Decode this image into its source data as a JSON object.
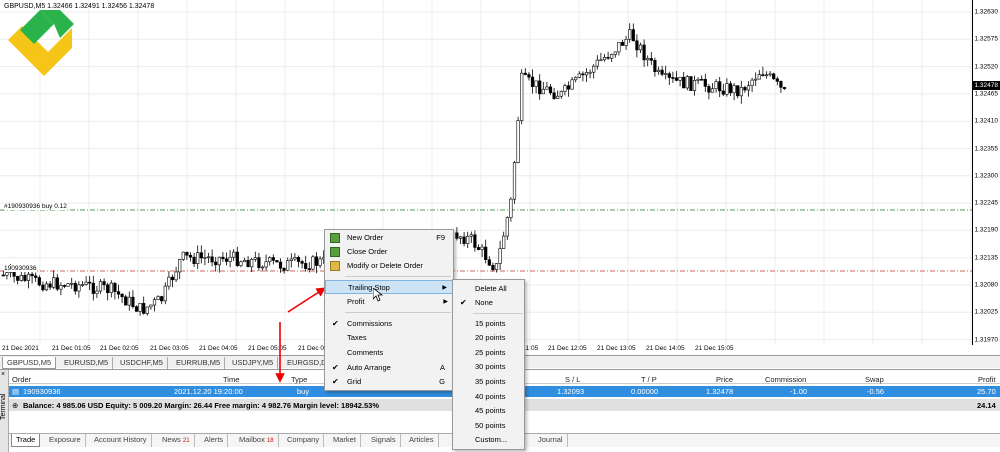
{
  "chart": {
    "title": "GBPUSD,M5   1.32466 1.32491 1.32456 1.32478",
    "price_labels": [
      "1.32630",
      "1.32575",
      "1.32520",
      "1.32465",
      "1.32410",
      "1.32355",
      "1.32300",
      "1.32245",
      "1.32190",
      "1.32135",
      "1.32080",
      "1.32025",
      "1.31970"
    ],
    "current_price": "1.32478",
    "time_labels": [
      "21 Dec 2021",
      "21 Dec 01:05",
      "21 Dec 02:05",
      "21 Dec 03:05",
      "21 Dec 04:05",
      "21 Dec 05:05",
      "21 Dec 06:05",
      "21 Dec 11:05",
      "21 Dec 12:05",
      "21 Dec 13:05",
      "21 Dec 14:05",
      "21 Dec 15:05"
    ],
    "tp_label": "#190930936 buy 0.12",
    "entry_label": "190930936"
  },
  "chart_tabs": [
    "GBPUSD,M5",
    "EURUSD,M5",
    "USDCHF,M5",
    "EURRUB,M5",
    "USDJPY,M5",
    "EURGSD,D"
  ],
  "terminal": {
    "side_title": "Terminal",
    "headers": [
      "Order",
      "Time",
      "Type",
      "S / L",
      "T / P",
      "Price",
      "Commission",
      "Swap",
      "Profit"
    ],
    "row": {
      "order": "190930936",
      "time": "2021.12.20 19:20:00",
      "type": "buy",
      "sl": "1.32093",
      "tp": "0.00000",
      "price": "1.32478",
      "commission": "-1.00",
      "swap": "-0.56",
      "profit": "25.70"
    },
    "balance": "Balance: 4 985.06 USD  Equity: 5 009.20  Margin: 26.44  Free margin: 4 982.76  Margin level: 18942.53%",
    "balance_profit": "24.14",
    "tabs": [
      {
        "label": "Trade",
        "badge": ""
      },
      {
        "label": "Exposure",
        "badge": ""
      },
      {
        "label": "Account History",
        "badge": ""
      },
      {
        "label": "News",
        "badge": "21"
      },
      {
        "label": "Alerts",
        "badge": ""
      },
      {
        "label": "Mailbox",
        "badge": "18"
      },
      {
        "label": "Company",
        "badge": ""
      },
      {
        "label": "Market",
        "badge": ""
      },
      {
        "label": "Signals",
        "badge": ""
      },
      {
        "label": "Articles",
        "badge": ""
      },
      {
        "label": "Journal",
        "badge": ""
      }
    ]
  },
  "context_menu": {
    "new_order": "New Order",
    "new_order_sc": "F9",
    "close_order": "Close Order",
    "modify_order": "Modify or Delete Order",
    "trailing_stop": "Trailing Stop",
    "profit": "Profit",
    "commissions": "Commissions",
    "taxes": "Taxes",
    "comments": "Comments",
    "auto_arrange": "Auto Arrange",
    "auto_arrange_sc": "A",
    "grid": "Grid",
    "grid_sc": "G"
  },
  "trailing_menu": {
    "items": [
      "Delete All",
      "None",
      "15 points",
      "20 points",
      "25 points",
      "30 points",
      "35 points",
      "40 points",
      "45 points",
      "50 points",
      "Custom..."
    ]
  }
}
